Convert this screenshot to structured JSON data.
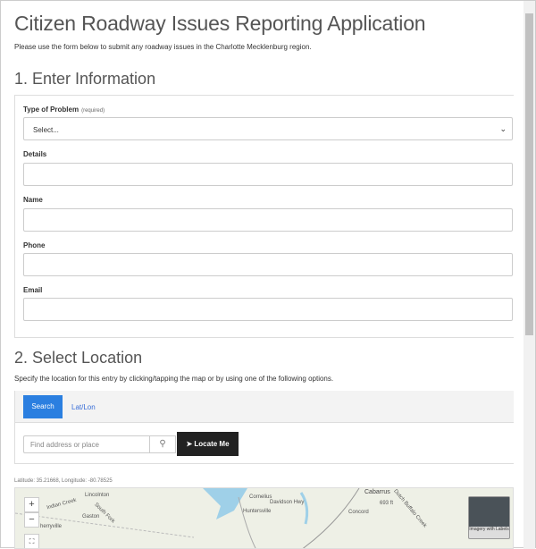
{
  "title": "Citizen Roadway Issues Reporting Application",
  "subtitle": "Please use the form below to submit any roadway issues in the Charlotte Mecklenburg region.",
  "section1": {
    "heading": "1. Enter Information",
    "type_label": "Type of Problem",
    "type_required": "(required)",
    "type_value": "Select...",
    "details_label": "Details",
    "name_label": "Name",
    "phone_label": "Phone",
    "email_label": "Email"
  },
  "section2": {
    "heading": "2. Select Location",
    "instructions": "Specify the location for this entry by clicking/tapping the map or by using one of the following options.",
    "tabs": [
      "Search",
      "Lat/Lon"
    ],
    "search_placeholder": "Find address or place",
    "locate_label": "Locate Me",
    "coords": "Latitude: 35.21668, Longitude: -80.78525"
  },
  "map": {
    "labels": [
      "Lincolnton",
      "Cornelius",
      "Cabarrus",
      "Huntersville",
      "Concord",
      "Gaston",
      "herryville",
      "Indian Creek",
      "South Fork",
      "Davidson Hwy",
      "693 ft",
      "Dutch Buffalo Creek"
    ],
    "zoom_in": "+",
    "zoom_out": "−",
    "basemap_label": "Imagery with Labels"
  }
}
